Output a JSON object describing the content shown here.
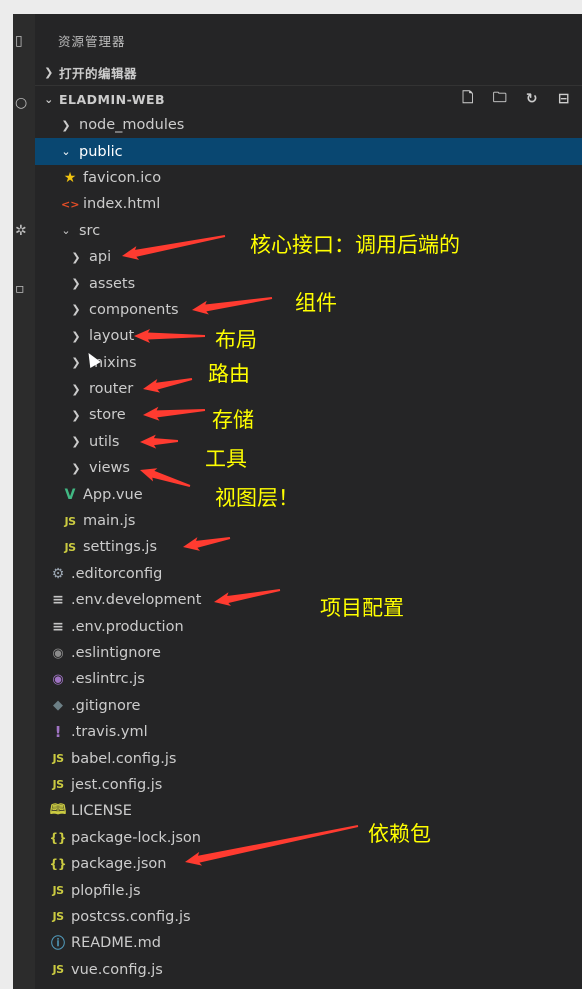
{
  "explorer": {
    "title": "资源管理器",
    "open_editors": {
      "label": "打开的编辑器",
      "icon": "chevron-right-icon",
      "expanded": false
    },
    "project": {
      "label": "ELADMIN-WEB",
      "icon": "chevron-down-icon",
      "expanded": true,
      "actions": [
        {
          "name": "new-file-icon",
          "glyph": "🗋"
        },
        {
          "name": "new-folder-icon",
          "glyph": "🗀"
        },
        {
          "name": "refresh-icon",
          "glyph": "↻"
        },
        {
          "name": "collapse-all-icon",
          "glyph": "⊟"
        }
      ]
    }
  },
  "tree": [
    {
      "label": "node_modules",
      "kind": "folder",
      "expanded": false,
      "depth": 1
    },
    {
      "label": "public",
      "kind": "folder",
      "expanded": true,
      "depth": 1,
      "selected": true
    },
    {
      "label": "favicon.ico",
      "kind": "file",
      "icon": "star-icon",
      "glyph": "★",
      "depth": 2
    },
    {
      "label": "index.html",
      "kind": "file",
      "icon": "html-icon",
      "glyph": "<>",
      "depth": 2
    },
    {
      "label": "src",
      "kind": "folder",
      "expanded": true,
      "depth": 1
    },
    {
      "label": "api",
      "kind": "folder",
      "expanded": false,
      "depth": 2
    },
    {
      "label": "assets",
      "kind": "folder",
      "expanded": false,
      "depth": 2
    },
    {
      "label": "components",
      "kind": "folder",
      "expanded": false,
      "depth": 2
    },
    {
      "label": "layout",
      "kind": "folder",
      "expanded": false,
      "depth": 2
    },
    {
      "label": "mixins",
      "kind": "folder",
      "expanded": false,
      "depth": 2
    },
    {
      "label": "router",
      "kind": "folder",
      "expanded": false,
      "depth": 2
    },
    {
      "label": "store",
      "kind": "folder",
      "expanded": false,
      "depth": 2
    },
    {
      "label": "utils",
      "kind": "folder",
      "expanded": false,
      "depth": 2
    },
    {
      "label": "views",
      "kind": "folder",
      "expanded": false,
      "depth": 2
    },
    {
      "label": "App.vue",
      "kind": "file",
      "icon": "vue-icon",
      "glyph": "V",
      "depth": 2
    },
    {
      "label": "main.js",
      "kind": "file",
      "icon": "js-icon",
      "glyph": "JS",
      "depth": 2
    },
    {
      "label": "settings.js",
      "kind": "file",
      "icon": "js-icon",
      "glyph": "JS",
      "depth": 2
    },
    {
      "label": ".editorconfig",
      "kind": "file",
      "icon": "gear-icon",
      "glyph": "⚙",
      "depth": 1
    },
    {
      "label": ".env.development",
      "kind": "file",
      "icon": "lines-icon",
      "glyph": "≡",
      "depth": 1
    },
    {
      "label": ".env.production",
      "kind": "file",
      "icon": "lines-icon",
      "glyph": "≡",
      "depth": 1
    },
    {
      "label": ".eslintignore",
      "kind": "file",
      "icon": "eslint-icon",
      "glyph": "◉",
      "depth": 1
    },
    {
      "label": ".eslintrc.js",
      "kind": "file",
      "icon": "eslint-config-icon",
      "glyph": "◉",
      "depth": 1
    },
    {
      "label": ".gitignore",
      "kind": "file",
      "icon": "git-icon",
      "glyph": "◆",
      "depth": 1
    },
    {
      "label": ".travis.yml",
      "kind": "file",
      "icon": "yml-icon",
      "glyph": "!",
      "depth": 1
    },
    {
      "label": "babel.config.js",
      "kind": "file",
      "icon": "js-icon",
      "glyph": "JS",
      "depth": 1
    },
    {
      "label": "jest.config.js",
      "kind": "file",
      "icon": "js-icon",
      "glyph": "JS",
      "depth": 1
    },
    {
      "label": "LICENSE",
      "kind": "file",
      "icon": "license-icon",
      "glyph": "🕮",
      "depth": 1
    },
    {
      "label": "package-lock.json",
      "kind": "file",
      "icon": "json-icon",
      "glyph": "{}",
      "depth": 1
    },
    {
      "label": "package.json",
      "kind": "file",
      "icon": "json-icon",
      "glyph": "{}",
      "depth": 1
    },
    {
      "label": "plopfile.js",
      "kind": "file",
      "icon": "js-icon",
      "glyph": "JS",
      "depth": 1
    },
    {
      "label": "postcss.config.js",
      "kind": "file",
      "icon": "js-icon",
      "glyph": "JS",
      "depth": 1
    },
    {
      "label": "README.md",
      "kind": "file",
      "icon": "info-icon",
      "glyph": "ⓘ",
      "depth": 1
    },
    {
      "label": "vue.config.js",
      "kind": "file",
      "icon": "js-icon",
      "glyph": "JS",
      "depth": 1
    }
  ],
  "annotations": [
    {
      "text": "核心接口：调用后端的",
      "target": "api"
    },
    {
      "text": "组件",
      "target": "components"
    },
    {
      "text": "布局",
      "target": "layout"
    },
    {
      "text": "路由",
      "target": "router"
    },
    {
      "text": "存储",
      "target": "store"
    },
    {
      "text": "工具",
      "target": "utils"
    },
    {
      "text": "视图层！",
      "target": "views"
    },
    {
      "text": "",
      "target": "settings.js"
    },
    {
      "text": "项目配置",
      "target": ".env.development"
    },
    {
      "text": "依赖包",
      "target": "package.json"
    }
  ],
  "colors": {
    "background": "#252526",
    "selected_row": "#094771",
    "annotation_text": "#ffff00",
    "annotation_arrow": "#ff3b30"
  }
}
